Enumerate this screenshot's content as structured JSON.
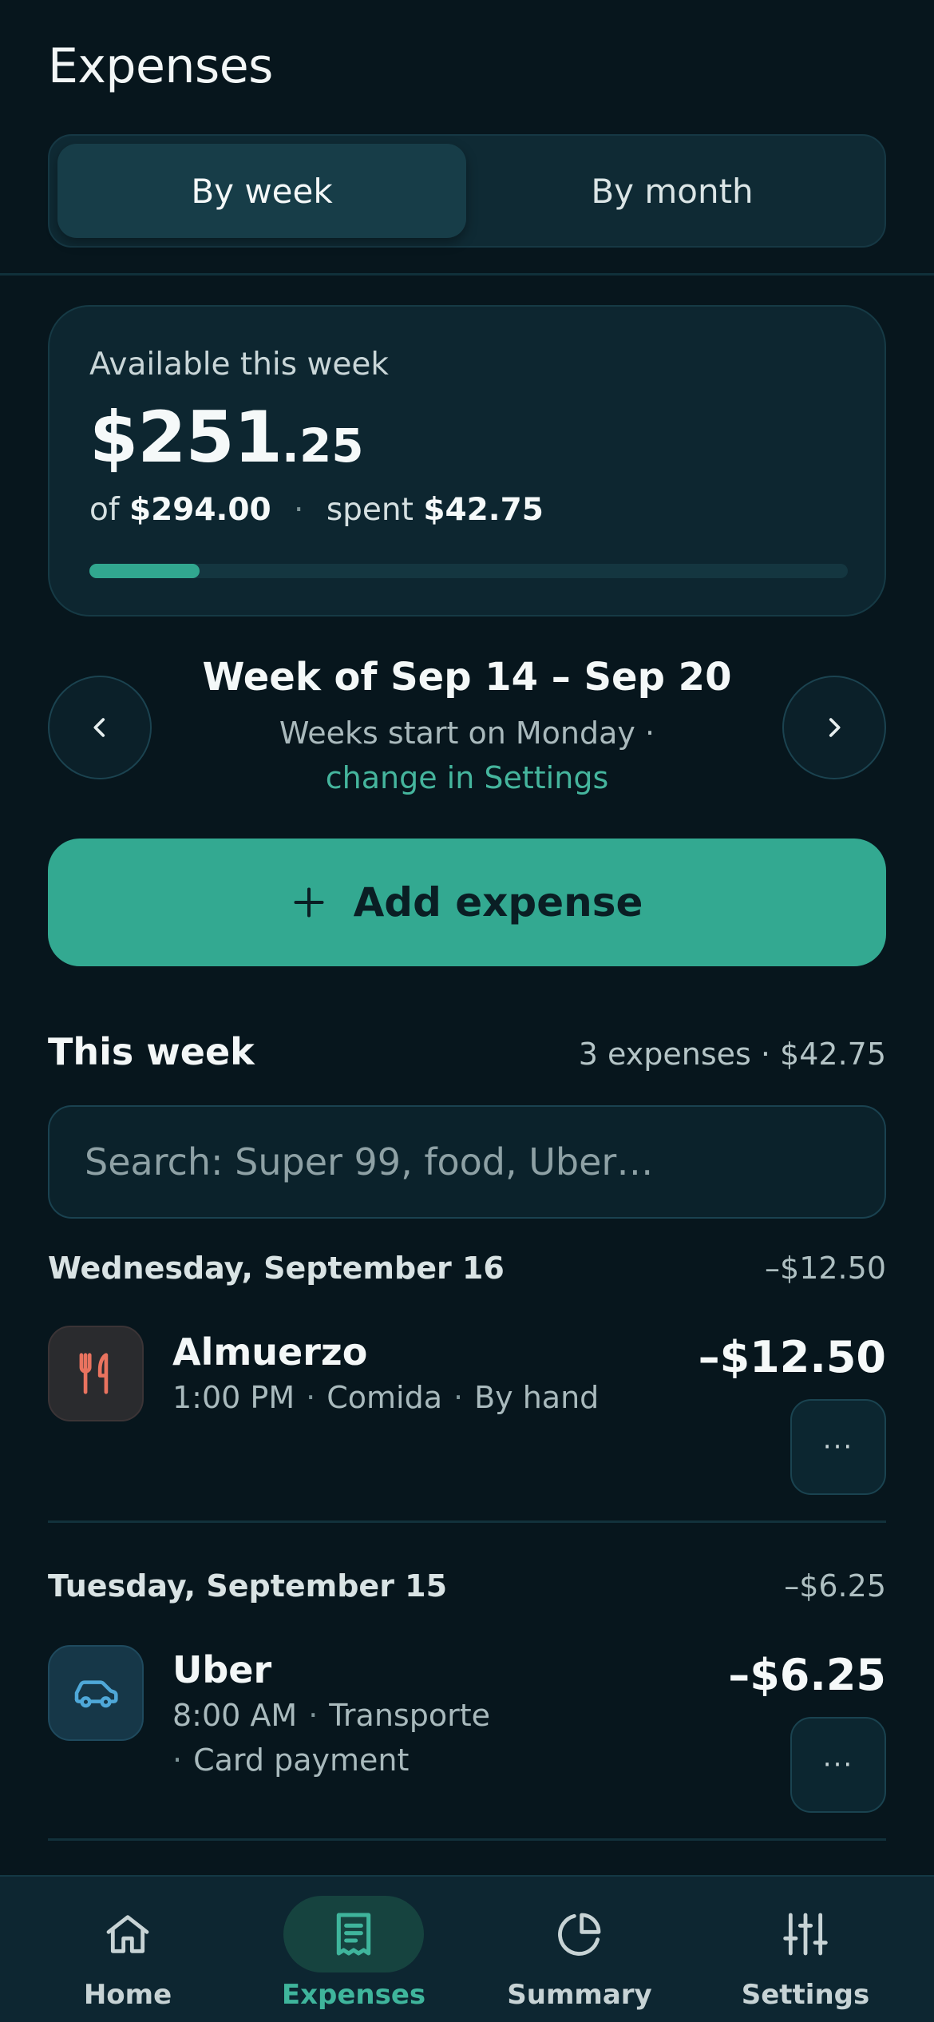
{
  "header": {
    "title": "Expenses"
  },
  "period_toggle": {
    "week_label": "By week",
    "month_label": "By month",
    "selected": "By week"
  },
  "budget": {
    "label": "Available this week",
    "available_main": "$251",
    "available_cents": ".25",
    "of_prefix": "of",
    "total": "$294.00",
    "separator": "·",
    "spent_prefix": "spent",
    "spent": "$42.75",
    "progress_percent": 14.5,
    "progress_color": "#31a78f"
  },
  "week_nav": {
    "prev_icon": "chevron-left-icon",
    "next_icon": "chevron-right-icon",
    "title": "Week of Sep 14 – Sep 20",
    "note": "Weeks start on Monday ·",
    "link": "change in Settings"
  },
  "add_button": {
    "icon": "plus-icon",
    "label": "Add expense",
    "color": "#33a991"
  },
  "list": {
    "title": "This week",
    "summary": "3 expenses · $42.75",
    "search_placeholder": "Search: Super 99, food, Uber…",
    "search_value": ""
  },
  "days": [
    {
      "name": "Wednesday, September 16",
      "total": "–$12.50",
      "expenses": [
        {
          "icon": "fork-knife-icon",
          "name": "Almuerzo",
          "time": "1:00 PM",
          "category": "Comida",
          "method": "By hand",
          "amount": "–$12.50",
          "more": "···"
        }
      ]
    },
    {
      "name": "Tuesday, September 15",
      "total": "–$6.25",
      "expenses": [
        {
          "icon": "car-icon",
          "name": "Uber",
          "time": "8:00 AM",
          "category": "Transporte",
          "method": "Card payment",
          "amount": "–$6.25",
          "more": "···"
        }
      ]
    }
  ],
  "bottom_nav": {
    "items": [
      {
        "label": "Home",
        "icon": "home-icon"
      },
      {
        "label": "Expenses",
        "icon": "receipt-icon"
      },
      {
        "label": "Summary",
        "icon": "pie-chart-icon"
      },
      {
        "label": "Settings",
        "icon": "sliders-icon"
      }
    ],
    "active": "Expenses",
    "accent": "#3fb59c"
  }
}
